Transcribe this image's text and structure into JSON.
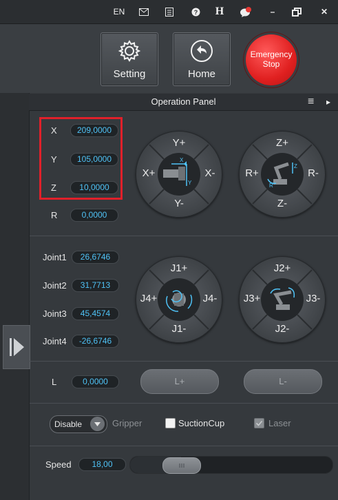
{
  "topbar": {
    "lang": "EN",
    "mail_icon": "mail-icon",
    "notes_icon": "notes-icon",
    "help_icon": "help-icon",
    "h_label": "H",
    "chat_icon": "chat-icon",
    "chat_badge": "!",
    "minimize": "–",
    "restore": "restore-icon",
    "close": "✕"
  },
  "header": {
    "setting_label": "Setting",
    "home_label": "Home",
    "estop_line1": "Emergency",
    "estop_line2": "Stop"
  },
  "panel": {
    "title": "Operation Panel",
    "menu_icon": "≡",
    "arrow_icon": "▸"
  },
  "coords": [
    {
      "label": "X",
      "value": "209,0000"
    },
    {
      "label": "Y",
      "value": "105,0000"
    },
    {
      "label": "Z",
      "value": "10,0000"
    },
    {
      "label": "R",
      "value": "0,0000"
    }
  ],
  "dials": {
    "xy": {
      "top": "Y+",
      "bottom": "Y-",
      "left": "X+",
      "right": "X-"
    },
    "zr": {
      "top": "Z+",
      "bottom": "Z-",
      "left": "R+",
      "right": "R-"
    },
    "j1j4": {
      "top": "J1+",
      "bottom": "J1-",
      "left": "J4+",
      "right": "J4-"
    },
    "j2j3": {
      "top": "J2+",
      "bottom": "J2-",
      "left": "J3+",
      "right": "J3-"
    }
  },
  "joints": [
    {
      "label": "Joint1",
      "value": "26,6746"
    },
    {
      "label": "Joint2",
      "value": "31,7713"
    },
    {
      "label": "Joint3",
      "value": "45,4574"
    },
    {
      "label": "Joint4",
      "value": "-26,6746"
    }
  ],
  "linear": {
    "label": "L",
    "value": "0,0000",
    "plus": "L+",
    "minus": "L-"
  },
  "tools": {
    "select_value": "Disable",
    "gripper": "Gripper",
    "suction": "SuctionCup",
    "laser": "Laser"
  },
  "speed": {
    "label": "Speed",
    "value": "18,00",
    "fraction": 0.18
  },
  "colors": {
    "accent": "#4fc3f7",
    "estop": "#e02020",
    "highlight": "#e0202a"
  }
}
